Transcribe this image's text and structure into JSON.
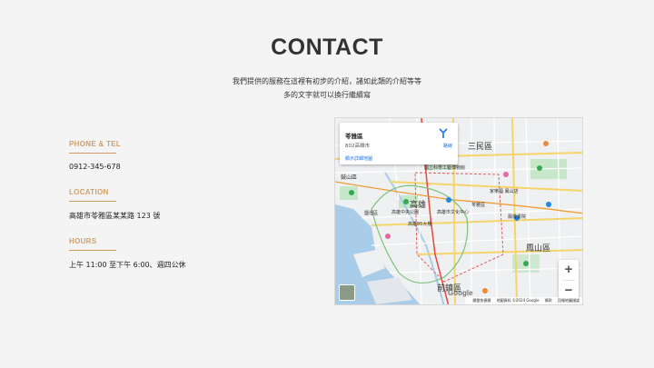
{
  "page": {
    "title": "CONTACT",
    "intro_line1": "我們提供的服務在這裡有初步的介紹，諸如此類的介紹等等",
    "intro_line2": "多的文字就可以換行繼續寫"
  },
  "contact": {
    "phone_heading": "PHONE & TEL",
    "phone_value": "0912-345-678",
    "location_heading": "LOCATION",
    "location_value": "高雄市苓雅區某某路 123 號",
    "hours_heading": "HOURS",
    "hours_value": "上午 11:00 至下午 6:00、週四公休"
  },
  "map": {
    "place_name": "苓雅區",
    "place_address": "802高雄市",
    "view_larger": "顯示詳細地圖",
    "directions": "路線",
    "zoom_in": "+",
    "zoom_out": "−",
    "google_logo": "Google",
    "attr_shortcuts": "鍵盤快捷鍵",
    "attr_data": "地圖資料 ©2024 Google",
    "attr_terms": "條款",
    "attr_report": "回報地圖錯誤",
    "labels": {
      "sanmin": "三民區",
      "gushan": "鼓山區",
      "gaoxiong": "高雄",
      "fengshan": "鳳山區",
      "qianzhen": "前鎮區",
      "lingya": "苓雅區",
      "yanchang": "鹽埕區",
      "museum": "國立科學工藝博物館",
      "central_park": "高雄中央公園",
      "culture_center": "高雄市文化中心",
      "tower": "高雄85大樓",
      "carrefour": "家樂福 鳳山店",
      "ruins": "鳳儀書院"
    }
  }
}
